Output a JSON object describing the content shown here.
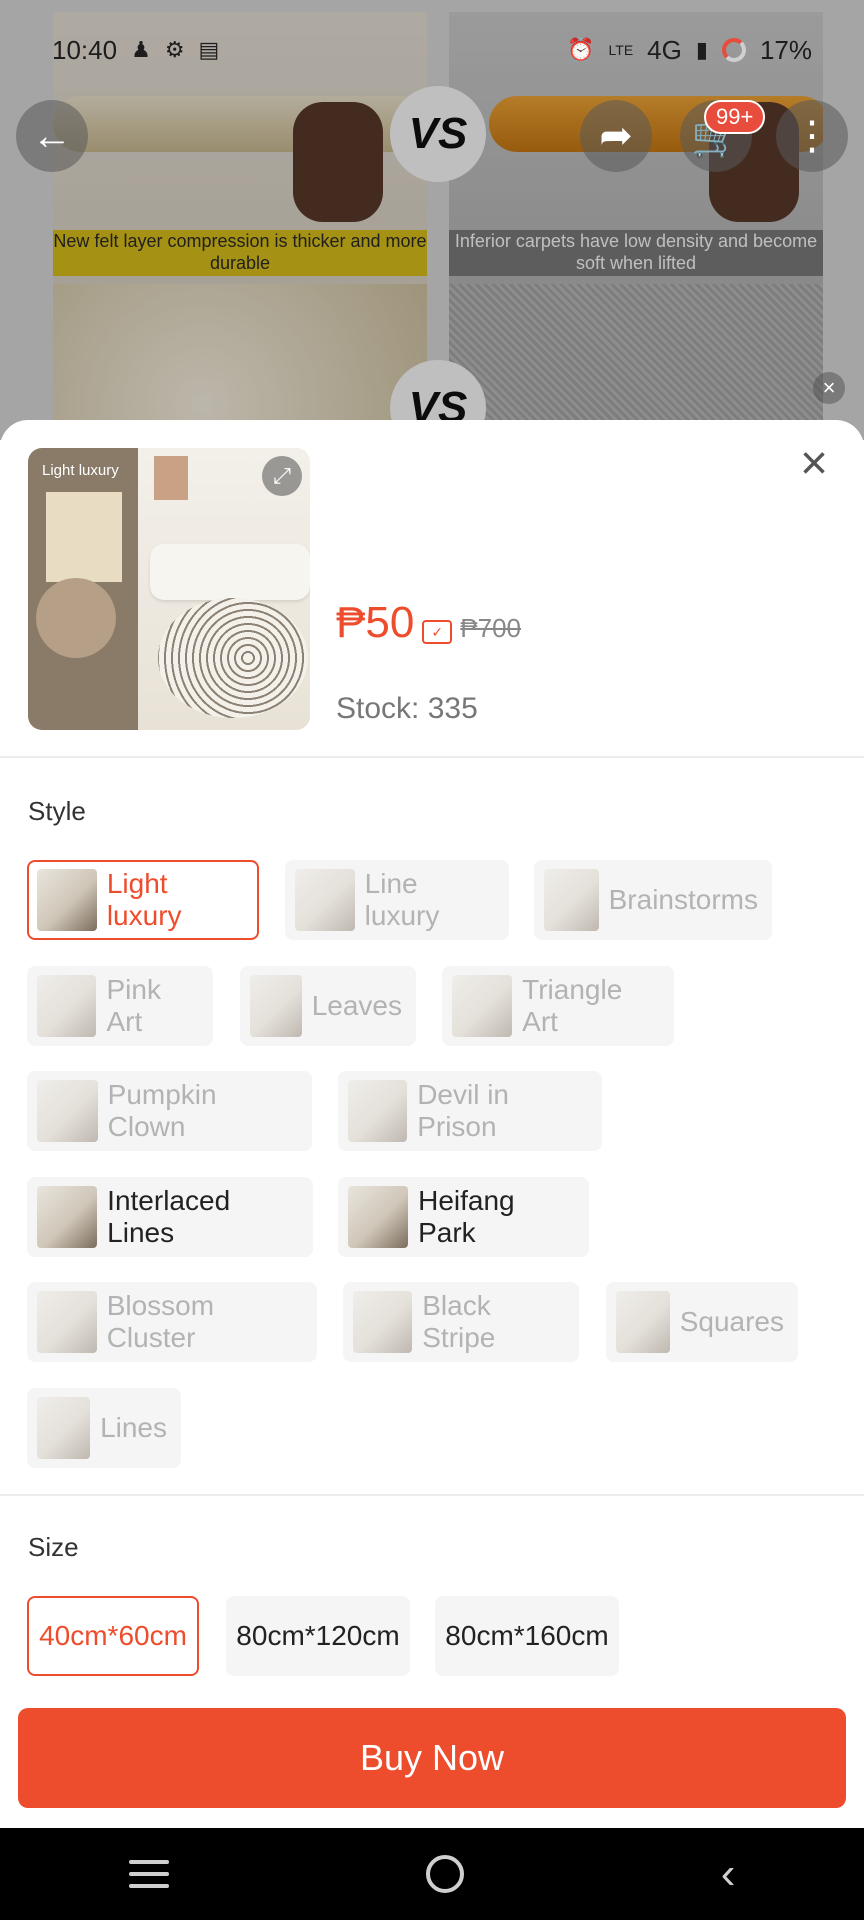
{
  "status_bar": {
    "time": "10:40",
    "network": "4G",
    "lte_label": "LTE",
    "battery": "17%",
    "icons": [
      "person-icon",
      "settings-icon",
      "card-icon",
      "alarm-icon",
      "volte-icon",
      "signal-icon",
      "battery-ring-icon"
    ]
  },
  "background": {
    "vs_label": "VS",
    "caption_left": "New felt layer compression is thicker and more durable",
    "caption_right": "Inferior carpets have low density and become soft when lifted",
    "cart_badge": "99+"
  },
  "product": {
    "thumb_label": "Light luxury",
    "price": "₱50",
    "original_price": "₱700",
    "stock": "Stock: 335"
  },
  "style": {
    "label": "Style",
    "options": [
      {
        "label": "Light luxury",
        "state": "selected"
      },
      {
        "label": "Line luxury",
        "state": "disabled"
      },
      {
        "label": "Brainstorms",
        "state": "disabled"
      },
      {
        "label": "Pink Art",
        "state": "disabled"
      },
      {
        "label": "Leaves",
        "state": "disabled"
      },
      {
        "label": "Triangle Art",
        "state": "disabled"
      },
      {
        "label": "Pumpkin Clown",
        "state": "disabled"
      },
      {
        "label": "Devil in Prison",
        "state": "disabled"
      },
      {
        "label": "Interlaced Lines",
        "state": "available"
      },
      {
        "label": "Heifang Park",
        "state": "available"
      },
      {
        "label": "Blossom Cluster",
        "state": "disabled"
      },
      {
        "label": "Black Stripe",
        "state": "disabled"
      },
      {
        "label": "Squares",
        "state": "disabled"
      },
      {
        "label": "Lines",
        "state": "disabled"
      }
    ]
  },
  "size": {
    "label": "Size",
    "options": [
      {
        "label": "40cm*60cm",
        "state": "selected"
      },
      {
        "label": "80cm*120cm",
        "state": "available"
      },
      {
        "label": "80cm*160cm",
        "state": "available"
      }
    ]
  },
  "buy_button": "Buy Now",
  "colors": {
    "accent": "#ee4d2d",
    "disabled_text": "#b3b3b3",
    "chip_bg": "#f5f5f5"
  }
}
